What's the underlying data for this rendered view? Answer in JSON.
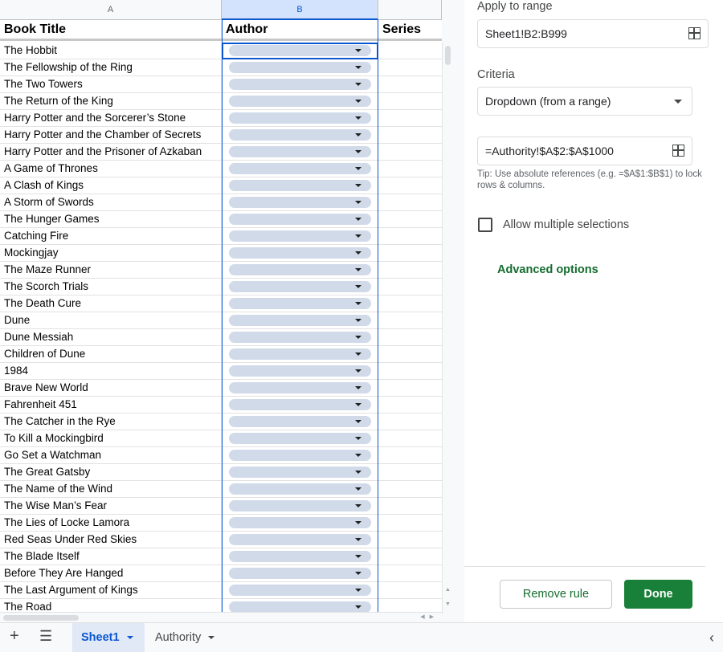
{
  "columns": {
    "a": "A",
    "b": "B"
  },
  "headers": {
    "title": "Book Title",
    "author": "Author",
    "series": "Series"
  },
  "rows": [
    "The Hobbit",
    "The Fellowship of the Ring",
    "The Two Towers",
    "The Return of the King",
    "Harry Potter and the Sorcerer’s Stone",
    "Harry Potter and the Chamber of Secrets",
    "Harry Potter and the Prisoner of Azkaban",
    "A Game of Thrones",
    "A Clash of Kings",
    "A Storm of Swords",
    "The Hunger Games",
    "Catching Fire",
    "Mockingjay",
    "The Maze Runner",
    "The Scorch Trials",
    "The Death Cure",
    "Dune",
    "Dune Messiah",
    "Children of Dune",
    "1984",
    "Brave New World",
    "Fahrenheit 451",
    "The Catcher in the Rye",
    "To Kill a Mockingbird",
    "Go Set a Watchman",
    "The Great Gatsby",
    "The Name of the Wind",
    "The Wise Man’s Fear",
    "The Lies of Locke Lamora",
    "Red Seas Under Red Skies",
    "The Blade Itself",
    "Before They Are Hanged",
    "The Last Argument of Kings",
    "The Road"
  ],
  "panel": {
    "apply_label": "Apply to range",
    "apply_value": "Sheet1!B2:B999",
    "criteria_label": "Criteria",
    "criteria_value": "Dropdown (from a range)",
    "range_value": "=Authority!$A$2:$A$1000",
    "tip": "Tip: Use absolute references (e.g. =$A$1:$B$1) to lock rows & columns.",
    "allow_multiple": "Allow multiple selections",
    "advanced": "Advanced options",
    "remove_btn": "Remove rule",
    "done_btn": "Done"
  },
  "tabs": {
    "add_icon": "plus-icon",
    "menu_icon": "menu-icon",
    "sheet1": "Sheet1",
    "authority": "Authority"
  },
  "colors": {
    "accent": "#0b57d0",
    "done": "#188038",
    "chip": "#d1dae9"
  }
}
